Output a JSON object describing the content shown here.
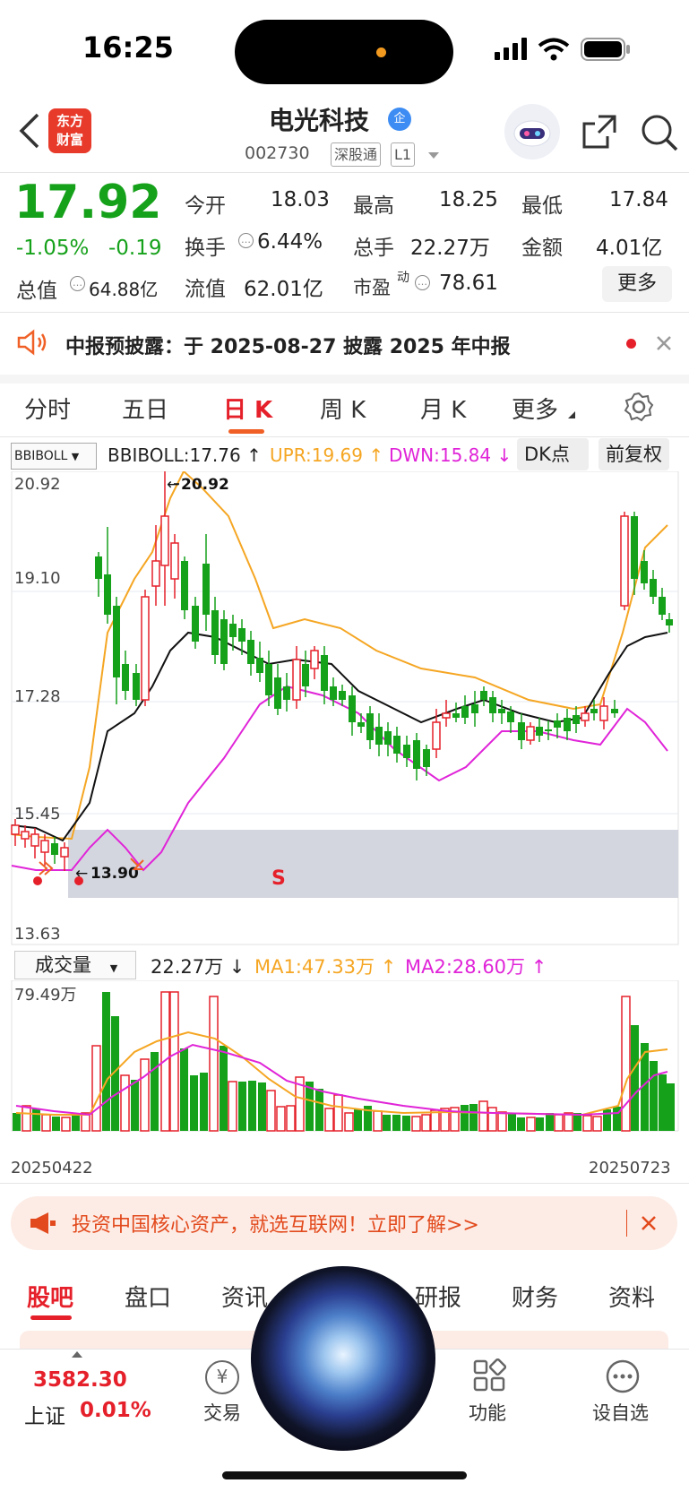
{
  "status_bar": {
    "time": "16:25"
  },
  "header": {
    "logo_text_1": "东方",
    "logo_text_2": "财富",
    "stock_name": "电光科技",
    "name_badge": "企",
    "stock_code": "002730",
    "tag_market": "深股通",
    "tag_level": "L1"
  },
  "quote": {
    "price": "17.92",
    "change_pct": "-1.05%",
    "change": "-0.19",
    "open_label": "今开",
    "open": "18.03",
    "high_label": "最高",
    "high": "18.25",
    "low_label": "最低",
    "low": "17.84",
    "turnover_label": "换手",
    "turnover": "6.44%",
    "volume_label": "总手",
    "volume": "22.27万",
    "amount_label": "金额",
    "amount": "4.01亿",
    "mktcap_label": "总值",
    "mktcap": "64.88亿",
    "float_label": "流值",
    "float": "62.01亿",
    "pe_label": "市盈",
    "pe_sup": "动",
    "pe": "78.61",
    "more": "更多"
  },
  "notice": {
    "text": "中报预披露：于 2025-08-27 披露 2025 年中报"
  },
  "period_tabs": [
    "分时",
    "五日",
    "日 K",
    "周 K",
    "月 K",
    "更多"
  ],
  "indicator": {
    "select": "BBIBOLL",
    "bbiboll": "BBIBOLL:17.76",
    "upr": "UPR:19.69",
    "dwn": "DWN:15.84",
    "dk_button": "DK点",
    "adjust_button": "前复权"
  },
  "price_axis": {
    "top": "20.92",
    "l2": "19.10",
    "l3": "17.28",
    "l4": "15.45",
    "bottom": "13.63"
  },
  "annotations": {
    "high_mark": "20.92",
    "low_mark": "13.90",
    "sell_mark": "S"
  },
  "volume": {
    "select": "成交量",
    "current": "22.27万",
    "ma1": "MA1:47.33万",
    "ma2": "MA2:28.60万",
    "max_label": "79.49万",
    "date_start": "20250422",
    "date_end": "20250723"
  },
  "ad": {
    "text": "投资中国核心资产，就选互联网！立即了解>>"
  },
  "content_tabs": [
    "股吧",
    "盘口",
    "资讯",
    "研报",
    "财务",
    "资料"
  ],
  "bottom_bar": {
    "index_value": "3582.30",
    "index_name": "上证",
    "index_pct": "0.01%",
    "trade_icon_char": "¥",
    "trade": "交易",
    "func": "功能",
    "watchlist": "设自选"
  },
  "colors": {
    "up": "#e5202a",
    "down": "#16a11b",
    "upr": "#f5a623",
    "dwn": "#e024d8",
    "mid": "#111111",
    "accent": "#f06026"
  }
}
